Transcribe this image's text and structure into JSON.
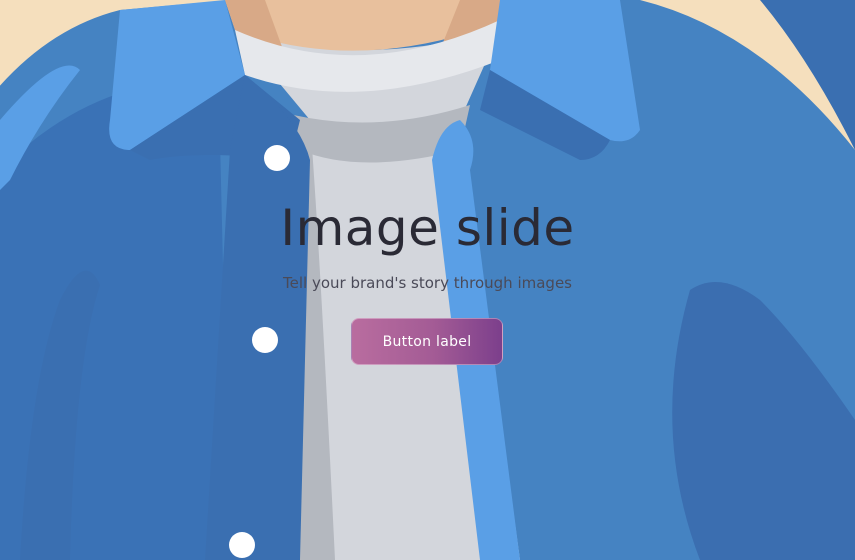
{
  "slide": {
    "title": "Image slide",
    "subtitle": "Tell your brand's story through images",
    "button_label": "Button label"
  },
  "colors": {
    "background": "#f5dfbd",
    "shirt_blue": "#4583c2",
    "shirt_blue_dark": "#3a6fb1",
    "collar_blue": "#5a9fe6",
    "tshirt_gray": "#d3d6dc",
    "skin": "#e8c09d",
    "button_gradient_start": "#b96d9f",
    "button_gradient_end": "#7c3f8c",
    "title_text": "#2a2a35"
  },
  "illustration": {
    "subject": "person-in-blue-denim-shirt-over-gray-tshirt",
    "shirt_buttons_visible": 3
  }
}
